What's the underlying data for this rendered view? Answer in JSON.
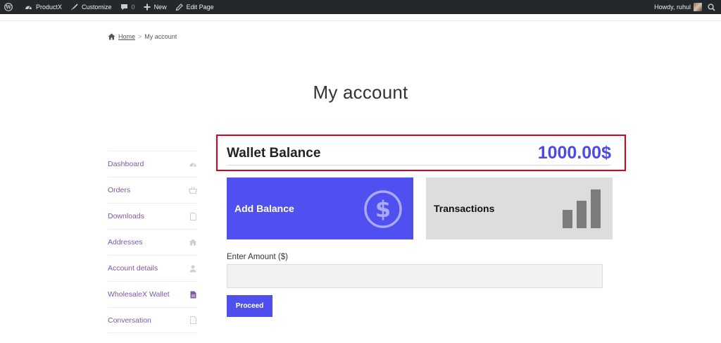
{
  "admin_bar": {
    "site_name": "ProductX",
    "customize": "Customize",
    "comments_count": "0",
    "new": "New",
    "edit_page": "Edit Page",
    "howdy": "Howdy, ruhul"
  },
  "breadcrumb": {
    "home": "Home",
    "separator": ">",
    "current": "My account"
  },
  "page_title": "My account",
  "nav": {
    "items": [
      {
        "label": "Dashboard",
        "icon": "dashboard-icon"
      },
      {
        "label": "Orders",
        "icon": "basket-icon"
      },
      {
        "label": "Downloads",
        "icon": "file-icon"
      },
      {
        "label": "Addresses",
        "icon": "home-icon"
      },
      {
        "label": "Account details",
        "icon": "user-icon"
      },
      {
        "label": "WholesaleX Wallet",
        "icon": "file-icon",
        "active": true
      },
      {
        "label": "Conversation",
        "icon": "file-icon"
      }
    ]
  },
  "wallet": {
    "label": "Wallet Balance",
    "amount": "1000.00$"
  },
  "cards": {
    "add_balance": "Add Balance",
    "transactions": "Transactions"
  },
  "form": {
    "amount_label": "Enter Amount ($)",
    "amount_value": "",
    "amount_placeholder": "",
    "proceed": "Proceed"
  },
  "colors": {
    "accent": "#5050f0",
    "nav_link": "#7b5aa6",
    "highlight_border": "#e0001a",
    "admin_bar": "#23282d"
  }
}
